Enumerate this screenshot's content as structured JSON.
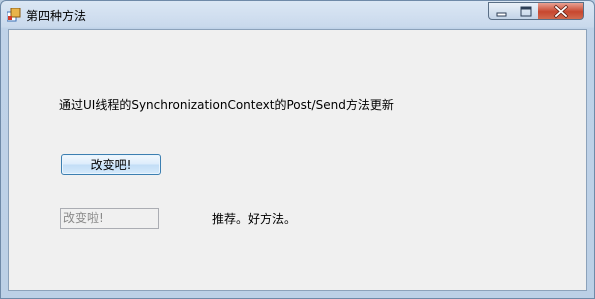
{
  "window": {
    "title": "第四种方法"
  },
  "content": {
    "description": "通过UI线程的SynchronizationContext的Post/Send方法更新",
    "button_label": "改变吧!",
    "result_value": "改变啦!",
    "note": "推荐。好方法。"
  },
  "icons": {
    "app": "window-app-icon",
    "minimize": "minimize-icon",
    "maximize": "maximize-icon",
    "close": "close-icon"
  }
}
